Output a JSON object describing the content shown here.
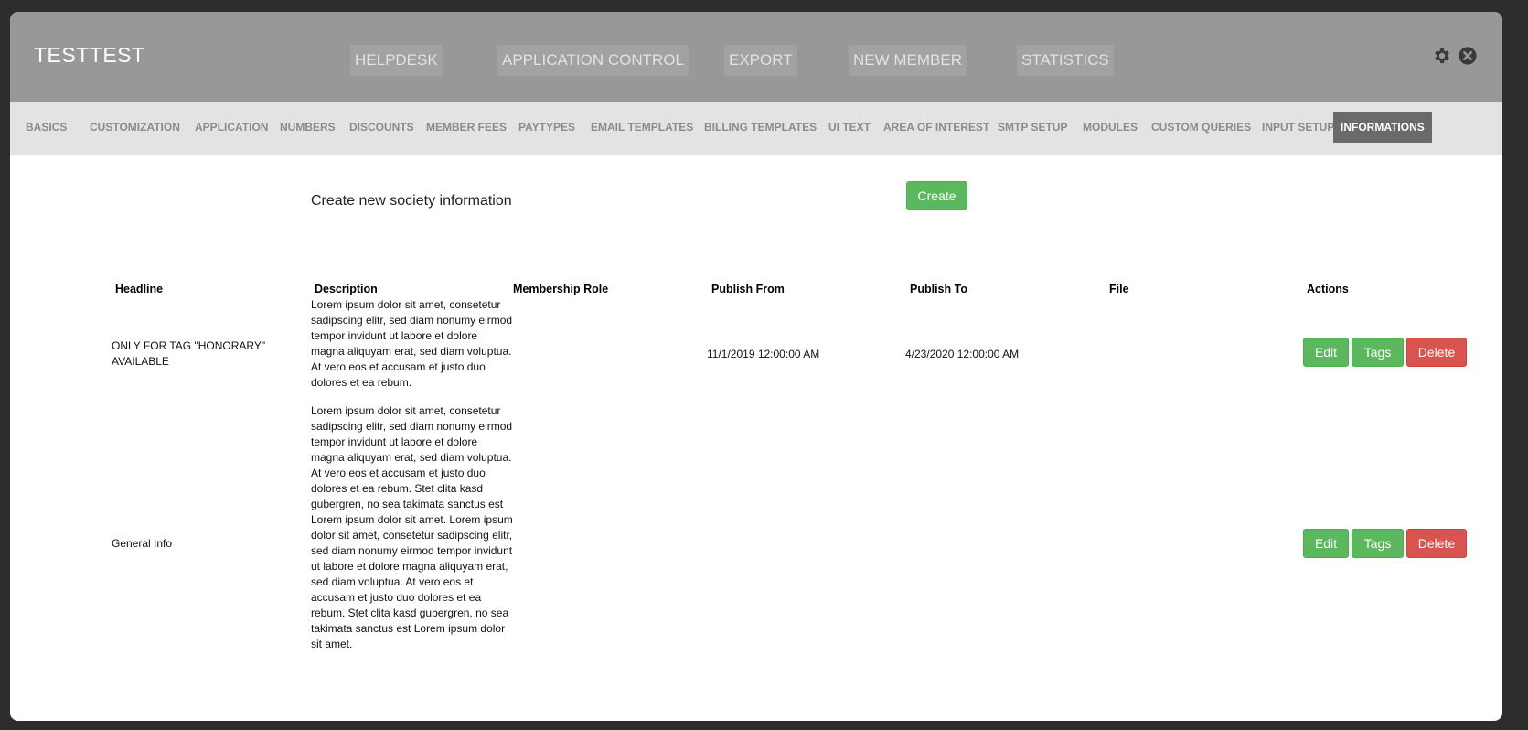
{
  "app": {
    "title": "TESTTEST"
  },
  "main_nav": {
    "items": [
      "HELPDESK",
      "APPLICATION CONTROL",
      "EXPORT",
      "NEW MEMBER",
      "STATISTICS"
    ]
  },
  "top_icons": [
    "gear-icon",
    "close-circle-icon"
  ],
  "sub_nav": {
    "items": [
      "BASICS",
      "CUSTOMIZATION",
      "APPLICATION",
      "NUMBERS",
      "DISCOUNTS",
      "MEMBER FEES",
      "PAYTYPES",
      "EMAIL TEMPLATES",
      "BILLING TEMPLATES",
      "UI TEXT",
      "AREA OF INTEREST",
      "SMTP SETUP",
      "MODULES",
      "CUSTOM QUERIES",
      "INPUT SETUP",
      "INFORMATIONS"
    ],
    "active": "INFORMATIONS"
  },
  "create_section": {
    "label": "Create new society information",
    "button_label": "Create"
  },
  "table": {
    "headers": {
      "headline": "Headline",
      "description": "Description",
      "membership_role": "Membership Role",
      "publish_from": "Publish From",
      "publish_to": "Publish To",
      "file": "File",
      "actions": "Actions"
    },
    "rows": [
      {
        "headline": "ONLY FOR TAG \"HONORARY\" AVAILABLE",
        "description": "Lorem ipsum dolor sit amet, consetetur sadipscing elitr, sed diam nonumy eirmod tempor invidunt ut labore et dolore magna aliquyam erat, sed diam voluptua. At vero eos et accusam et justo duo dolores et ea rebum.",
        "membership_role": "",
        "publish_from": "11/1/2019 12:00:00 AM",
        "publish_to": "4/23/2020 12:00:00 AM",
        "file": ""
      },
      {
        "headline": "General Info",
        "description": "Lorem ipsum dolor sit amet, consetetur sadipscing elitr, sed diam nonumy eirmod tempor invidunt ut labore et dolore magna aliquyam erat, sed diam voluptua. At vero eos et accusam et justo duo dolores et ea rebum. Stet clita kasd gubergren, no sea takimata sanctus est Lorem ipsum dolor sit amet. Lorem ipsum dolor sit amet, consetetur sadipscing elitr, sed diam nonumy eirmod tempor invidunt ut labore et dolore magna aliquyam erat, sed diam voluptua. At vero eos et accusam et justo duo dolores et ea rebum. Stet clita kasd gubergren, no sea takimata sanctus est Lorem ipsum dolor sit amet.",
        "membership_role": "",
        "publish_from": "",
        "publish_to": "",
        "file": ""
      }
    ],
    "action_labels": {
      "edit": "Edit",
      "tags": "Tags",
      "delete": "Delete"
    }
  },
  "colors": {
    "topbar": "#999799",
    "subnav": "#e3e3e3",
    "active_tab": "#6a6a6a",
    "success": "#5cb85c",
    "danger": "#d9534f"
  }
}
